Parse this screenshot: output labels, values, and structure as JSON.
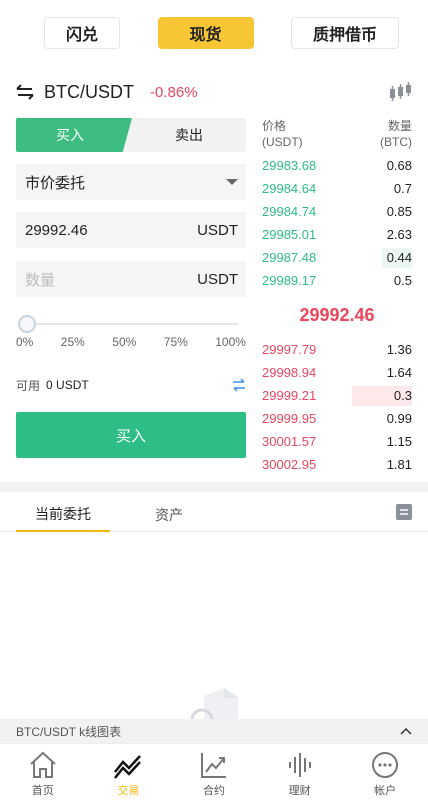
{
  "top_tabs": [
    "闪兑",
    "现货",
    "质押借币"
  ],
  "pair": {
    "name": "BTC/USDT",
    "change": "-0.86%"
  },
  "trade": {
    "buy_label": "买入",
    "sell_label": "卖出",
    "order_type": "市价委托",
    "price_value": "29992.46",
    "price_unit": "USDT",
    "amount_placeholder": "数量",
    "amount_unit": "USDT",
    "slider_marks": [
      "0%",
      "25%",
      "50%",
      "75%",
      "100%"
    ],
    "slider_level_percent": 0,
    "available_label": "可用",
    "available_amount": "0 USDT",
    "submit_label": "买入"
  },
  "orderbook": {
    "price_header": "价格",
    "price_header_unit": "(USDT)",
    "qty_header": "数量",
    "qty_header_unit": "(BTC)",
    "bids": [
      {
        "price": "29983.68",
        "qty": "0.68"
      },
      {
        "price": "29984.64",
        "qty": "0.7"
      },
      {
        "price": "29984.74",
        "qty": "0.85"
      },
      {
        "price": "29985.01",
        "qty": "2.63"
      },
      {
        "price": "29987.48",
        "qty": "0.44"
      },
      {
        "price": "29989.17",
        "qty": "0.5"
      }
    ],
    "last_price": "29992.46",
    "asks": [
      {
        "price": "29997.79",
        "qty": "1.36"
      },
      {
        "price": "29998.94",
        "qty": "1.64"
      },
      {
        "price": "29999.21",
        "qty": "0.3"
      },
      {
        "price": "29999.95",
        "qty": "0.99"
      },
      {
        "price": "30001.57",
        "qty": "1.15"
      },
      {
        "price": "30002.95",
        "qty": "1.81"
      }
    ]
  },
  "orders_tabs": {
    "current": "当前委托",
    "assets": "资产"
  },
  "kline_bar": {
    "label": "BTC/USDT k线图表"
  },
  "bottom_nav": [
    {
      "label": "首页",
      "icon": "home-icon"
    },
    {
      "label": "交易",
      "icon": "trade-icon"
    },
    {
      "label": "合约",
      "icon": "contract-icon"
    },
    {
      "label": "理财",
      "icon": "finance-icon"
    },
    {
      "label": "帐户",
      "icon": "account-icon"
    }
  ],
  "colors": {
    "accent": "#f7c634",
    "buy": "#2ebd85",
    "sell": "#e8475e",
    "active_nav": "#f0b90b"
  }
}
